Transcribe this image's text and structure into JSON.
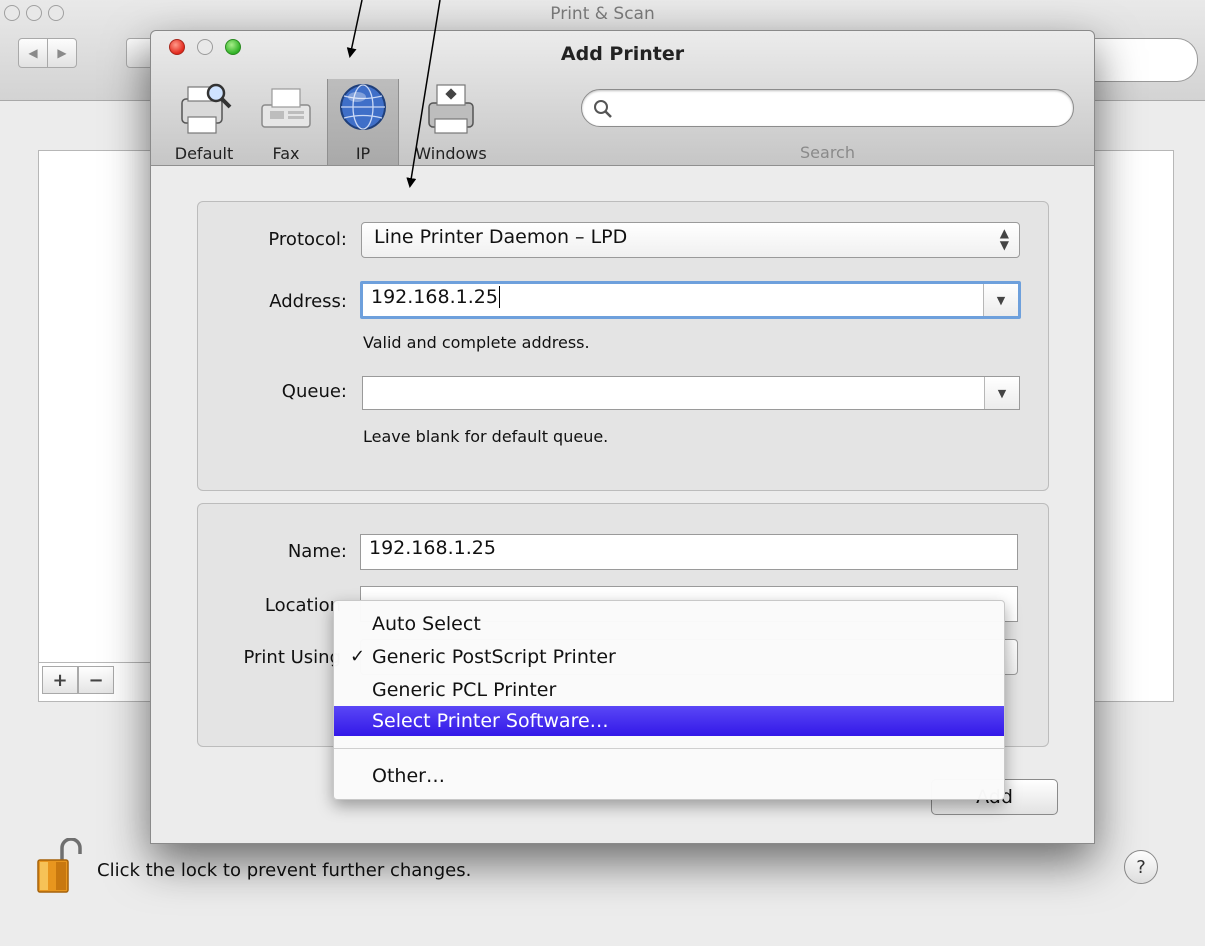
{
  "background_window": {
    "title": "Print & Scan",
    "lock_message": "Click the lock to prevent further changes.",
    "add_symbol": "+",
    "remove_symbol": "−",
    "help_symbol": "?",
    "back_symbol": "◀",
    "forward_symbol": "▶"
  },
  "dialog": {
    "title": "Add Printer",
    "toolbar": {
      "tabs": [
        {
          "label": "Default",
          "icon": "printer-search-icon"
        },
        {
          "label": "Fax",
          "icon": "fax-icon"
        },
        {
          "label": "IP",
          "icon": "globe-icon",
          "selected": true
        },
        {
          "label": "Windows",
          "icon": "windows-printer-icon"
        }
      ],
      "search_label": "Search",
      "search_value": ""
    },
    "connection": {
      "protocol_label": "Protocol:",
      "protocol_value": "Line Printer Daemon – LPD",
      "address_label": "Address:",
      "address_value": "192.168.1.25",
      "address_hint": "Valid and complete address.",
      "queue_label": "Queue:",
      "queue_value": "",
      "queue_hint": "Leave blank for default queue."
    },
    "identity": {
      "name_label": "Name:",
      "name_value": "192.168.1.25",
      "location_label": "Location",
      "print_using_label": "Print Using"
    },
    "add_button": "Add"
  },
  "print_using_menu": {
    "items": [
      {
        "label": "Auto Select",
        "checked": false,
        "highlighted": false
      },
      {
        "label": "Generic PostScript Printer",
        "checked": true,
        "highlighted": false
      },
      {
        "label": "Generic PCL Printer",
        "checked": false,
        "highlighted": false
      },
      {
        "label": "Select Printer Software…",
        "checked": false,
        "highlighted": true
      },
      {
        "label": "Other…",
        "checked": false,
        "highlighted": false
      }
    ],
    "check_mark": "✓"
  },
  "colors": {
    "highlight": "#3a20ec",
    "close_light": "#e2281c",
    "zoom_light": "#30b226",
    "focus_ring": "#6ea0dc"
  }
}
